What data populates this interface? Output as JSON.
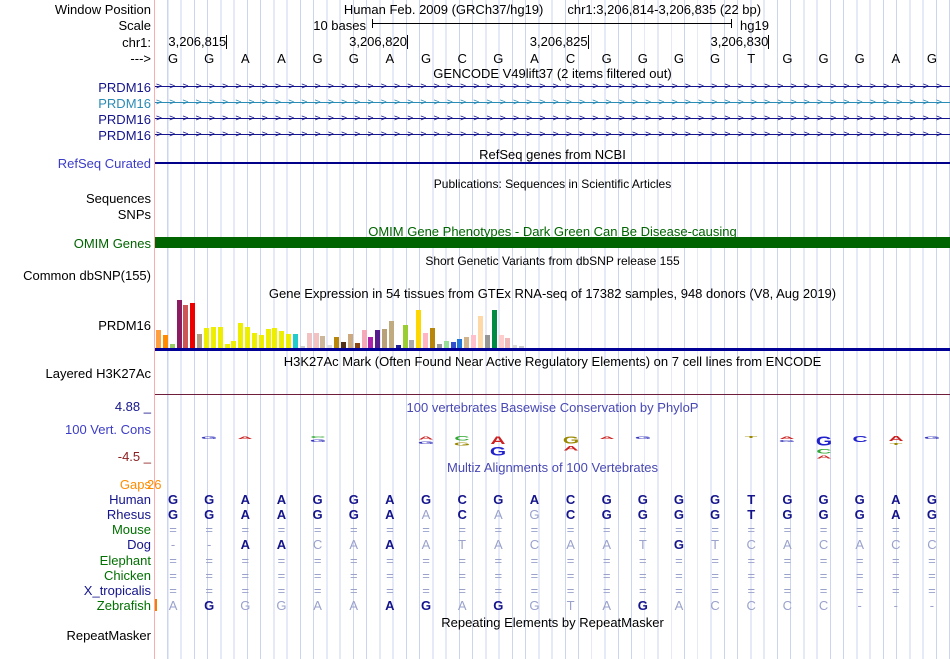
{
  "colors": {
    "navy": "#14148c",
    "teal_transcript": "#2a8bb5",
    "omim_green": "#006400",
    "title_blue": "#4848b4",
    "label_blue": "#3c3cc8",
    "maroon_min": "#8c2020",
    "h3k27ac_line": "#6e1e3c",
    "gtex_baseline": "#000096",
    "refseq_line": "#00008b",
    "grid_blue": "#cdd4f0",
    "boundary_pink": "#fbacac",
    "orange": "#ff8c00",
    "align_dark": "#14148c",
    "align_light": "#9aa2cc",
    "green_label": "#007000"
  },
  "header": {
    "window_position_label": "Window Position",
    "title_assembly": "Human Feb. 2009 (GRCh37/hg19)",
    "title_range": "chr1:3,206,814-3,206,835 (22 bp)",
    "scale_row_label": "Scale",
    "scale_label": "10 bases",
    "genome": "hg19",
    "chrom_label": "chr1:",
    "strand_label": "--->",
    "ruler_ticks": [
      {
        "text": "3,206,815",
        "base_index": 2
      },
      {
        "text": "3,206,820",
        "base_index": 7
      },
      {
        "text": "3,206,825",
        "base_index": 12
      },
      {
        "text": "3,206,830",
        "base_index": 17
      }
    ],
    "sequence": "GGAAGGAGCGACGGGGTGGGAG"
  },
  "gencode": {
    "title": "GENCODE V49lift37 (2 items filtered out)",
    "transcripts": [
      {
        "label": "PRDM16",
        "color": "#14148c"
      },
      {
        "label": "PRDM16",
        "color": "#2a8bb5"
      },
      {
        "label": "PRDM16",
        "color": "#14148c"
      },
      {
        "label": "PRDM16",
        "color": "#14148c"
      }
    ]
  },
  "refseq": {
    "title": "RefSeq genes from NCBI",
    "label": "RefSeq Curated"
  },
  "publications": {
    "title": "Publications: Sequences in Scientific Articles",
    "labels": [
      "Sequences",
      "SNPs"
    ]
  },
  "omim": {
    "title": "OMIM Gene Phenotypes - Dark Green Can Be Disease-causing",
    "label": "OMIM Genes"
  },
  "dbsnp": {
    "title": "Short Genetic Variants from dbSNP release 155",
    "label": "Common dbSNP(155)"
  },
  "gtex": {
    "title": "Gene Expression in 54 tissues from GTEx RNA-seq of 17382 samples, 948 donors (V8, Aug 2019)",
    "label": "PRDM16",
    "bars": [
      {
        "h": 18,
        "c": "#ffa040"
      },
      {
        "h": 13,
        "c": "#ff8c00"
      },
      {
        "h": 4,
        "c": "#9acd66"
      },
      {
        "h": 48,
        "c": "#8b1c62"
      },
      {
        "h": 43,
        "c": "#cd5555"
      },
      {
        "h": 45,
        "c": "#ee0000"
      },
      {
        "h": 14,
        "c": "#b09c80"
      },
      {
        "h": 20,
        "c": "#eeee00"
      },
      {
        "h": 21,
        "c": "#eeee00"
      },
      {
        "h": 21,
        "c": "#eeee00"
      },
      {
        "h": 4,
        "c": "#eeee00"
      },
      {
        "h": 7,
        "c": "#eeee00"
      },
      {
        "h": 25,
        "c": "#eeee00"
      },
      {
        "h": 21,
        "c": "#eeee00"
      },
      {
        "h": 15,
        "c": "#eeee00"
      },
      {
        "h": 13,
        "c": "#eeee00"
      },
      {
        "h": 19,
        "c": "#eeee00"
      },
      {
        "h": 20,
        "c": "#eeee00"
      },
      {
        "h": 17,
        "c": "#eeee00"
      },
      {
        "h": 14,
        "c": "#eeee00"
      },
      {
        "h": 14,
        "c": "#22cccc"
      },
      {
        "h": 2,
        "c": "#cccccc"
      },
      {
        "h": 15,
        "c": "#f2c2c2"
      },
      {
        "h": 15,
        "c": "#f2c2c2"
      },
      {
        "h": 12,
        "c": "#cdb79b"
      },
      {
        "h": 3,
        "c": "#dddddd"
      },
      {
        "h": 11,
        "c": "#b8860b"
      },
      {
        "h": 6,
        "c": "#513018"
      },
      {
        "h": 14,
        "c": "#cdaa7d"
      },
      {
        "h": 5,
        "c": "#8b4513"
      },
      {
        "h": 18,
        "c": "#f4a8b8"
      },
      {
        "h": 11,
        "c": "#aa22aa"
      },
      {
        "h": 18,
        "c": "#551a8b"
      },
      {
        "h": 19,
        "c": "#b8a078"
      },
      {
        "h": 27,
        "c": "#c0aa80"
      },
      {
        "h": 3,
        "c": "#202090"
      },
      {
        "h": 23,
        "c": "#9acd32"
      },
      {
        "h": 8,
        "c": "#aaaaaa"
      },
      {
        "h": 38,
        "c": "#ffd700"
      },
      {
        "h": 15,
        "c": "#ffb6c1"
      },
      {
        "h": 20,
        "c": "#b8860b"
      },
      {
        "h": 4,
        "c": "#999999"
      },
      {
        "h": 7,
        "c": "#98e098"
      },
      {
        "h": 6,
        "c": "#3050cc"
      },
      {
        "h": 9,
        "c": "#2277dd"
      },
      {
        "h": 11,
        "c": "#d2b48c"
      },
      {
        "h": 13,
        "c": "#ffc0cb"
      },
      {
        "h": 32,
        "c": "#ffd8a8"
      },
      {
        "h": 13,
        "c": "#969696"
      },
      {
        "h": 38,
        "c": "#008b45"
      },
      {
        "h": 13,
        "c": "#ffcccc"
      },
      {
        "h": 10,
        "c": "#f0b8b8"
      },
      {
        "h": 3,
        "c": "#d8d8d8"
      },
      {
        "h": 2,
        "c": "#cccccc"
      }
    ]
  },
  "h3k27ac": {
    "title": "H3K27Ac Mark (Often Found Near Active Regulatory Elements) on 7 cell lines from ENCODE",
    "label": "Layered H3K27Ac"
  },
  "phylop": {
    "title": "100 vertebrates Basewise Conservation by PhyloP",
    "label": "100 Vert. Cons",
    "max": "4.88 _",
    "min": "-4.5 _",
    "logo": [
      {
        "col": 2,
        "letters": [
          {
            "ch": "G",
            "c": "#3333bb",
            "h": 4
          }
        ]
      },
      {
        "col": 3,
        "letters": [
          {
            "ch": "A",
            "c": "#cc2222",
            "h": 4
          }
        ]
      },
      {
        "col": 5,
        "letters": [
          {
            "ch": "C",
            "c": "#33aa33",
            "h": 3
          },
          {
            "ch": "G",
            "c": "#3333bb",
            "h": 4
          }
        ]
      },
      {
        "col": 8,
        "letters": [
          {
            "ch": "A",
            "c": "#cc2222",
            "h": 5
          },
          {
            "ch": "G",
            "c": "#3333bb",
            "h": 4
          }
        ]
      },
      {
        "col": 9,
        "letters": [
          {
            "ch": "C",
            "c": "#33aa33",
            "h": 6
          },
          {
            "ch": "G",
            "c": "#998800",
            "h": 5
          }
        ]
      },
      {
        "col": 10,
        "letters": [
          {
            "ch": "A",
            "c": "#cc2222",
            "h": 11
          },
          {
            "ch": "G",
            "c": "#2222cc",
            "h": 12
          }
        ]
      },
      {
        "col": 12,
        "letters": [
          {
            "ch": "G",
            "c": "#998800",
            "h": 10
          },
          {
            "ch": "A",
            "c": "#cc2222",
            "h": 6
          }
        ]
      },
      {
        "col": 13,
        "letters": [
          {
            "ch": "A",
            "c": "#cc2222",
            "h": 4
          }
        ]
      },
      {
        "col": 14,
        "letters": [
          {
            "ch": "G",
            "c": "#3333bb",
            "h": 4
          }
        ]
      },
      {
        "col": 17,
        "letters": [
          {
            "ch": "T",
            "c": "#998800",
            "h": 3
          }
        ]
      },
      {
        "col": 18,
        "letters": [
          {
            "ch": "A",
            "c": "#cc2222",
            "h": 4
          },
          {
            "ch": "G",
            "c": "#3333bb",
            "h": 3
          }
        ]
      },
      {
        "col": 19,
        "letters": [
          {
            "ch": "G",
            "c": "#2222cc",
            "h": 13
          },
          {
            "ch": "C",
            "c": "#33aa33",
            "h": 6
          },
          {
            "ch": "A",
            "c": "#cc2222",
            "h": 5
          }
        ]
      },
      {
        "col": 20,
        "letters": [
          {
            "ch": "C",
            "c": "#2222cc",
            "h": 8
          }
        ]
      },
      {
        "col": 21,
        "letters": [
          {
            "ch": "A",
            "c": "#cc2222",
            "h": 7
          },
          {
            "ch": "T",
            "c": "#998800",
            "h": 3
          }
        ]
      },
      {
        "col": 22,
        "letters": [
          {
            "ch": "G",
            "c": "#3333bb",
            "h": 4
          }
        ]
      }
    ]
  },
  "multiz": {
    "title": "Multiz Alignments of 100 Vertebrates",
    "gaps_label": "Gaps",
    "gaps_value": "26",
    "rows": [
      {
        "label": "Human",
        "lc": "#14148c",
        "seq": "GGAAGGAGCGACGGGGTGGGAG",
        "shade": "dddddddddddddddddddddd"
      },
      {
        "label": "Rhesus",
        "lc": "#14148c",
        "seq": "GGAAGGAACAGCGGGGTGGGAG",
        "shade": "dddddddldllddddddddddd"
      },
      {
        "label": "Mouse",
        "lc": "#007000",
        "seq": "======================",
        "shade": "llllllllllllllllllllll"
      },
      {
        "label": "Dog",
        "lc": "#14148c",
        "seq": "--AACAAATACAATGTCACACC",
        "shade": "llddlldllllllldlllllll"
      },
      {
        "label": "Elephant",
        "lc": "#007000",
        "seq": "======================",
        "shade": "llllllllllllllllllllll"
      },
      {
        "label": "Chicken",
        "lc": "#007000",
        "seq": "======================",
        "shade": "llllllllllllllllllllll"
      },
      {
        "label": "X_tropicalis",
        "lc": "#14148c",
        "seq": "======================",
        "shade": "llllllllllllllllllllll"
      },
      {
        "label": "Zebrafish",
        "lc": "#007000",
        "seq": "AGGGAAAGAGGTAGACCCC---",
        "shade": "ldllllddldllldllllllll"
      }
    ]
  },
  "repeatmasker": {
    "title": "Repeating Elements by RepeatMasker",
    "label": "RepeatMasker"
  }
}
